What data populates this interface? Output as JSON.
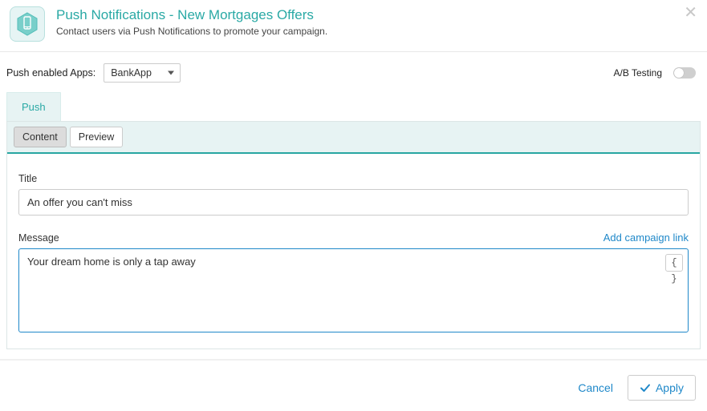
{
  "colors": {
    "accent": "#2aa9a5",
    "link": "#1f88c9",
    "tabbg": "#e7f3f3"
  },
  "header": {
    "title": "Push Notifications - New Mortgages Offers",
    "subtitle": "Contact users via Push Notifications to promote your campaign."
  },
  "toolbar": {
    "apps_label": "Push enabled Apps:",
    "selected_app": "BankApp",
    "ab_label": "A/B Testing",
    "ab_on": false
  },
  "main_tabs": [
    {
      "label": "Push",
      "active": true
    }
  ],
  "sub_tabs": [
    {
      "label": "Content",
      "active": true
    },
    {
      "label": "Preview",
      "active": false
    }
  ],
  "form": {
    "title_label": "Title",
    "title_value": "An offer you can't miss",
    "message_label": "Message",
    "add_link_label": "Add campaign link",
    "message_value": "Your dream home is only a tap away",
    "braces_label": "{ }"
  },
  "footer": {
    "cancel": "Cancel",
    "apply": "Apply"
  }
}
